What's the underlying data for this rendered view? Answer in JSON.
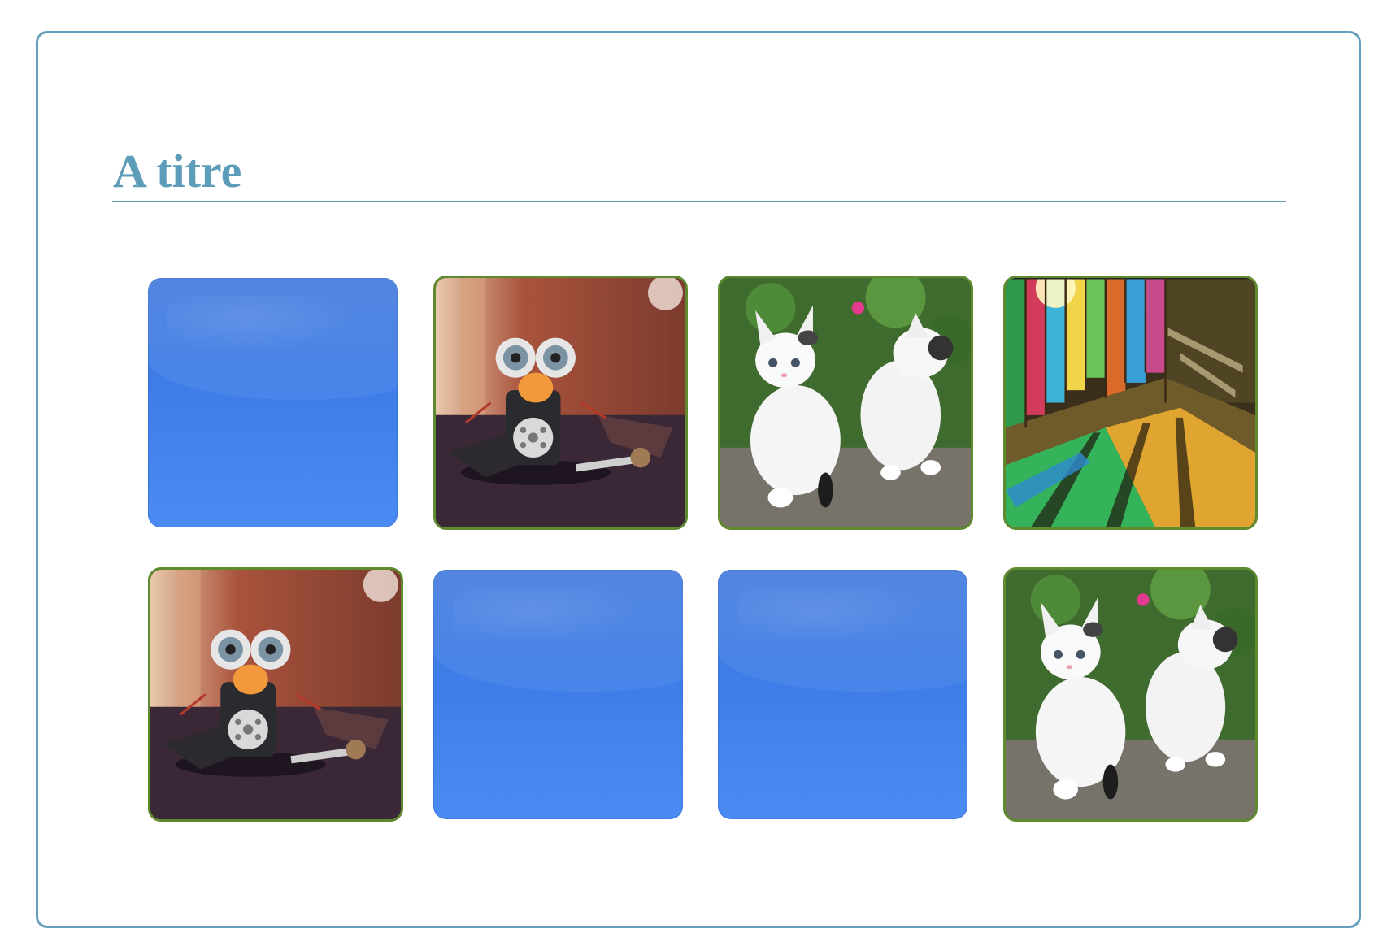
{
  "page": {
    "title": "A titre"
  },
  "board": {
    "cards": [
      {
        "state": "face-down",
        "image": "card-back"
      },
      {
        "state": "face-up",
        "image": "robot-toy"
      },
      {
        "state": "face-up",
        "image": "two-kittens"
      },
      {
        "state": "face-up",
        "image": "stained-glass-hall"
      },
      {
        "state": "face-up",
        "image": "robot-toy"
      },
      {
        "state": "face-down",
        "image": "card-back"
      },
      {
        "state": "face-down",
        "image": "card-back"
      },
      {
        "state": "face-up",
        "image": "two-kittens"
      }
    ]
  },
  "colors": {
    "title": "#5e9db9",
    "frame_border": "#64a0bc",
    "card_back": "#3e7de8",
    "card_face_border": "#5f8a2f"
  }
}
